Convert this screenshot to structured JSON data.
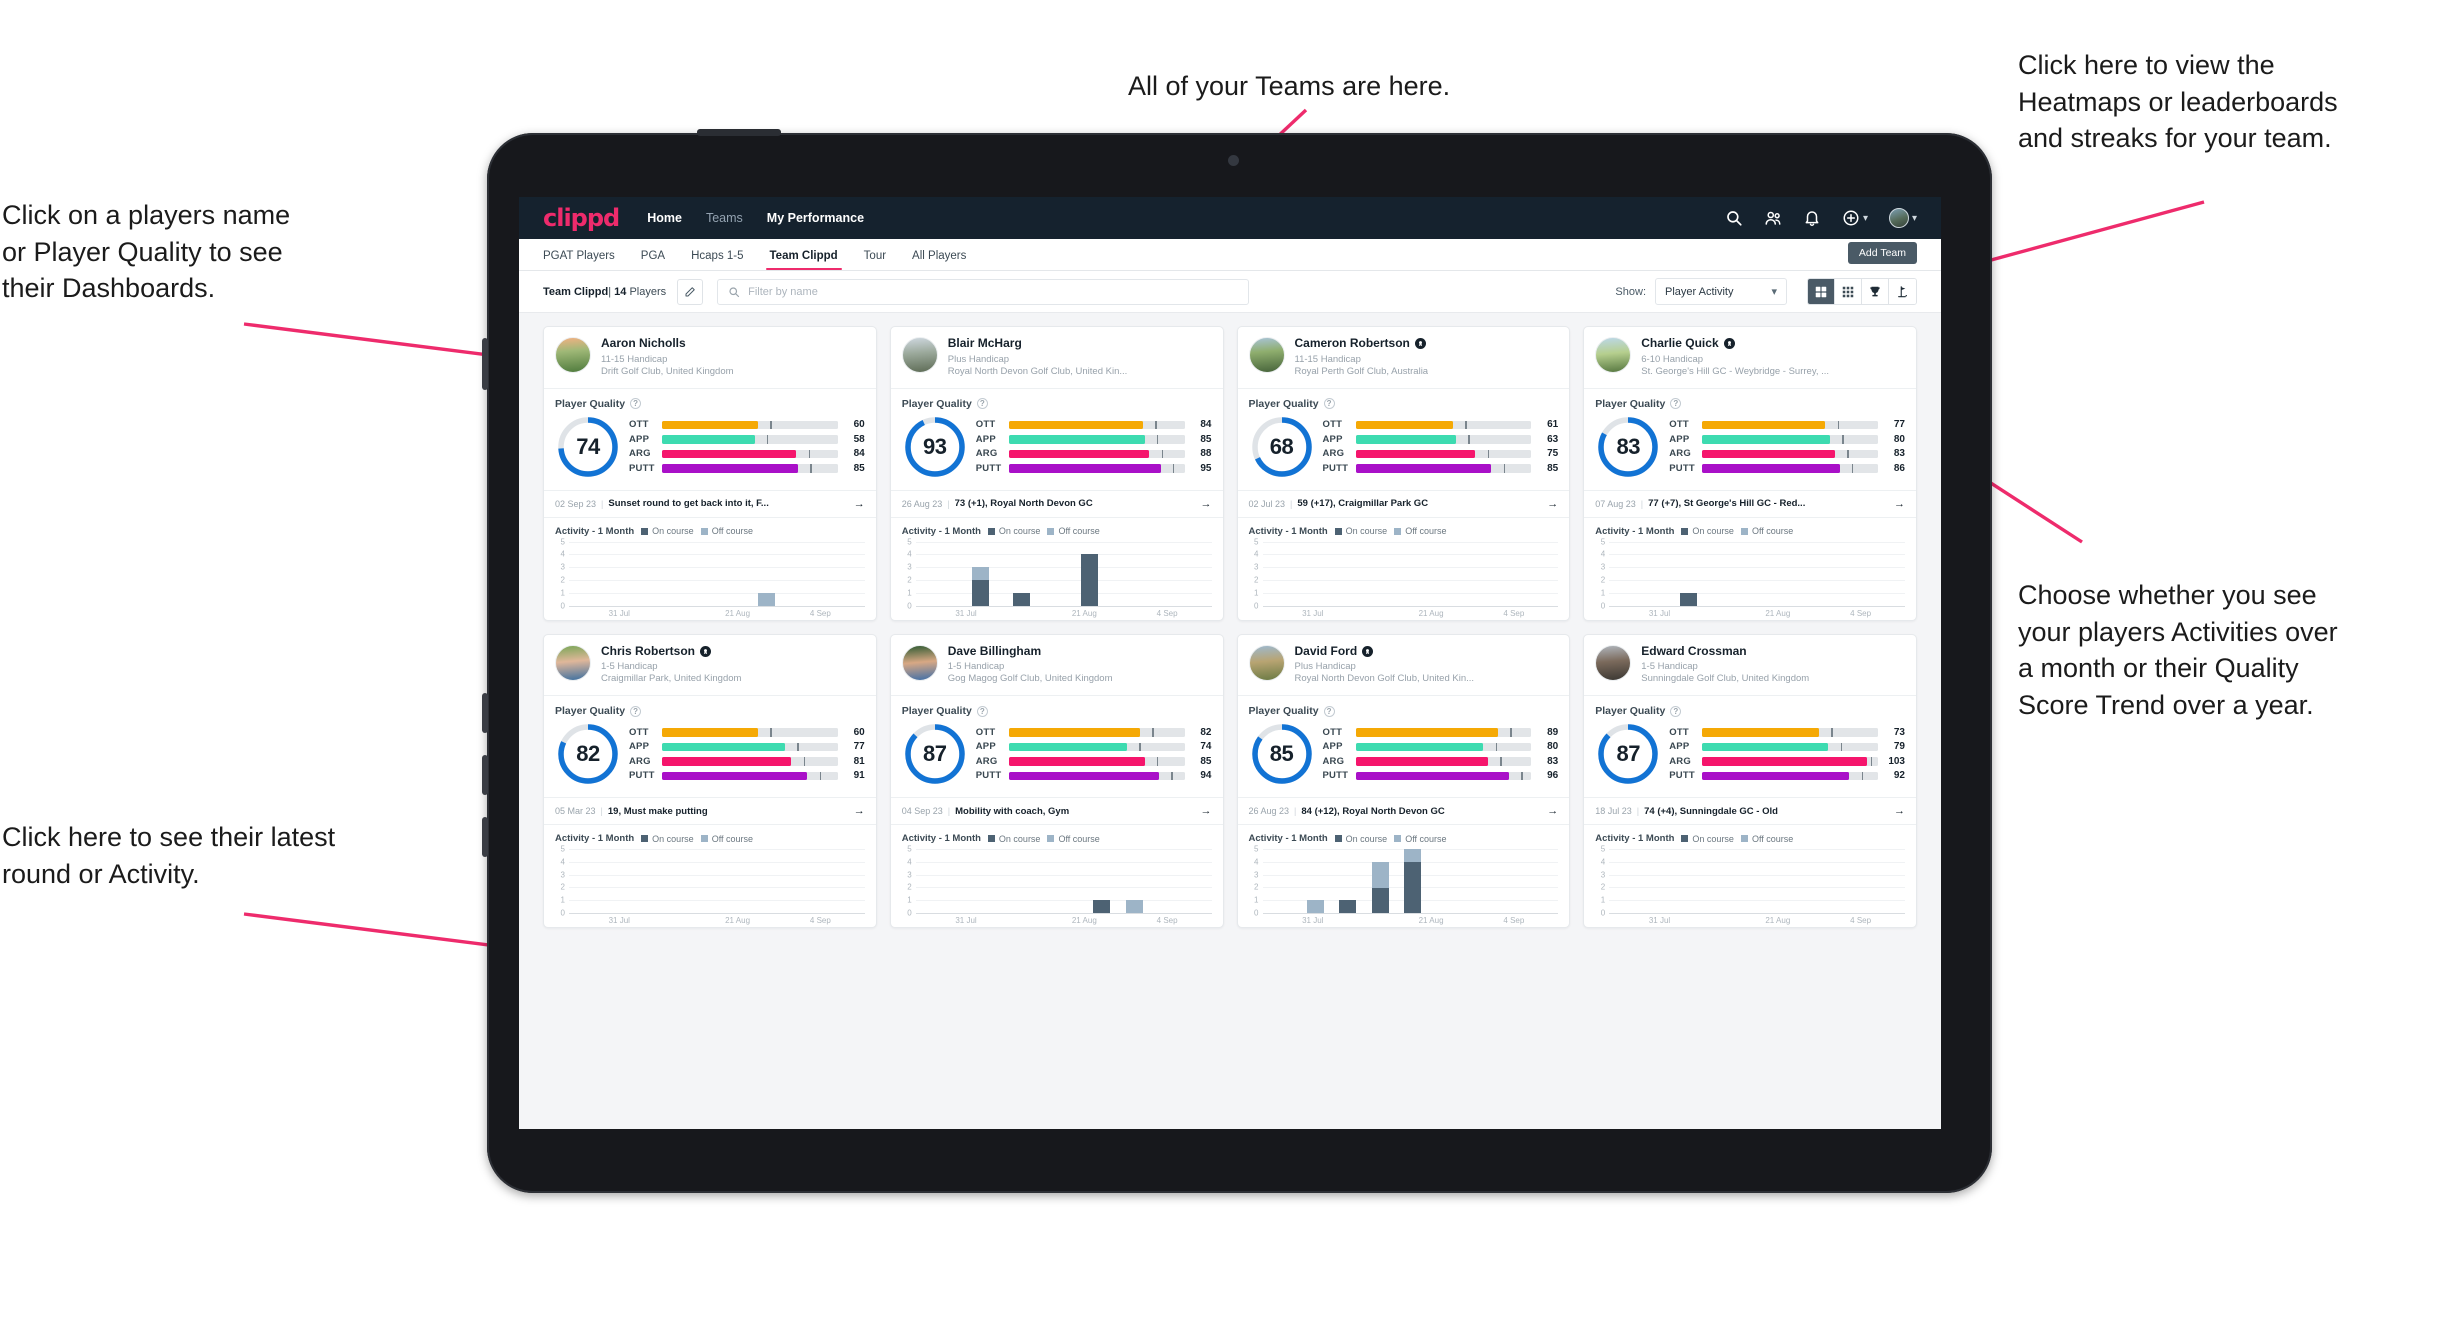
{
  "annotations": [
    {
      "id": "a-players",
      "text": "Click on a players name\nor Player Quality to see\ntheir Dashboards."
    },
    {
      "id": "a-teams",
      "text": "All of your Teams are here."
    },
    {
      "id": "a-heatmaps",
      "text": "Click here to view the\nHeatmaps or leaderboards\nand streaks for your team."
    },
    {
      "id": "a-activity",
      "text": "Choose whether you see\nyour players Activities over\na month or their Quality\nScore Trend over a year."
    },
    {
      "id": "a-latest",
      "text": "Click here to see their latest\nround or Activity."
    }
  ],
  "accent": "#ee2b6c",
  "topnav": {
    "logo": "clippd",
    "links": [
      {
        "label": "Home",
        "active": true
      },
      {
        "label": "Teams",
        "active": false
      },
      {
        "label": "My Performance",
        "active": true
      }
    ],
    "icons": [
      "search-icon",
      "people-icon",
      "bell-icon",
      "plus-circle-icon",
      "avatar"
    ]
  },
  "subtabs": {
    "tabs": [
      {
        "label": "PGAT Players",
        "active": false
      },
      {
        "label": "PGA",
        "active": false
      },
      {
        "label": "Hcaps 1-5",
        "active": false
      },
      {
        "label": "Team Clippd",
        "active": true
      },
      {
        "label": "Tour",
        "active": false
      },
      {
        "label": "All Players",
        "active": false
      }
    ],
    "add_team_label": "Add Team"
  },
  "filterbar": {
    "team_name": "Team Clippd",
    "separator": "|",
    "player_count": "14",
    "players_word": "Players",
    "edit_icon": "pencil-icon",
    "search_placeholder": "Filter by name",
    "show_label": "Show:",
    "show_value": "Player Activity",
    "view_buttons": [
      "grid-large-icon",
      "grid-small-icon",
      "trophy-icon",
      "golf-flag-icon"
    ]
  },
  "card_labels": {
    "player_quality": "Player Quality",
    "activity": "Activity - 1 Month",
    "legend_on": "On course",
    "legend_off": "Off course",
    "metrics": [
      "OTT",
      "APP",
      "ARG",
      "PUTT"
    ]
  },
  "metric_colors": {
    "OTT": "#f5a905",
    "APP": "#3ddbb0",
    "ARG": "#f5156c",
    "PUTT": "#a910c8",
    "ring": "#1273d4",
    "ring_track": "#dfe3e7",
    "on_course": "#4d6273",
    "off_course": "#9db4c7"
  },
  "chart_data": {
    "type": "bar",
    "title": "Activity - 1 Month",
    "ylabel": "",
    "xlabel": "",
    "ylim": [
      0,
      5
    ],
    "yticks": [
      0,
      1,
      2,
      3,
      4,
      5
    ],
    "xticks": [
      "31 Jul",
      "21 Aug",
      "4 Sep"
    ],
    "grid": true,
    "legend": [
      "On course",
      "Off course"
    ],
    "stacked": true
  },
  "players": [
    {
      "name": "Aaron Nicholls",
      "verified": false,
      "handicap": "11-15 Handicap",
      "club": "Drift Golf Club, United Kingdom",
      "quality": 74,
      "metrics": {
        "OTT": 60,
        "APP": 58,
        "ARG": 84,
        "PUTT": 85
      },
      "round": {
        "date": "02 Sep 23",
        "text": "Sunset round to get back into it, F..."
      },
      "activity": {
        "bars": [
          {
            "x": 0.64,
            "on": 0,
            "off": 1
          }
        ]
      }
    },
    {
      "name": "Blair McHarg",
      "verified": false,
      "handicap": "Plus Handicap",
      "club": "Royal North Devon Golf Club, United Kin...",
      "quality": 93,
      "metrics": {
        "OTT": 84,
        "APP": 85,
        "ARG": 88,
        "PUTT": 95
      },
      "round": {
        "date": "26 Aug 23",
        "text": "73 (+1), Royal North Devon GC"
      },
      "activity": {
        "bars": [
          {
            "x": 0.19,
            "on": 2,
            "off": 1
          },
          {
            "x": 0.33,
            "on": 1,
            "off": 0
          },
          {
            "x": 0.56,
            "on": 4,
            "off": 0
          }
        ]
      }
    },
    {
      "name": "Cameron Robertson",
      "verified": true,
      "handicap": "11-15 Handicap",
      "club": "Royal Perth Golf Club, Australia",
      "quality": 68,
      "metrics": {
        "OTT": 61,
        "APP": 63,
        "ARG": 75,
        "PUTT": 85
      },
      "round": {
        "date": "02 Jul 23",
        "text": "59 (+17), Craigmillar Park GC"
      },
      "activity": {
        "bars": []
      }
    },
    {
      "name": "Charlie Quick",
      "verified": true,
      "handicap": "6-10 Handicap",
      "club": "St. George's Hill GC - Weybridge - Surrey, ...",
      "quality": 83,
      "metrics": {
        "OTT": 77,
        "APP": 80,
        "ARG": 83,
        "PUTT": 86
      },
      "round": {
        "date": "07 Aug 23",
        "text": "77 (+7), St George's Hill GC - Red..."
      },
      "activity": {
        "bars": [
          {
            "x": 0.24,
            "on": 1,
            "off": 0
          }
        ]
      }
    },
    {
      "name": "Chris Robertson",
      "verified": true,
      "handicap": "1-5 Handicap",
      "club": "Craigmillar Park, United Kingdom",
      "quality": 82,
      "metrics": {
        "OTT": 60,
        "APP": 77,
        "ARG": 81,
        "PUTT": 91
      },
      "round": {
        "date": "05 Mar 23",
        "text": "19, Must make putting"
      },
      "activity": {
        "bars": []
      }
    },
    {
      "name": "Dave Billingham",
      "verified": false,
      "handicap": "1-5 Handicap",
      "club": "Gog Magog Golf Club, United Kingdom",
      "quality": 87,
      "metrics": {
        "OTT": 82,
        "APP": 74,
        "ARG": 85,
        "PUTT": 94
      },
      "round": {
        "date": "04 Sep 23",
        "text": "Mobility with coach, Gym"
      },
      "activity": {
        "bars": [
          {
            "x": 0.6,
            "on": 1,
            "off": 0
          },
          {
            "x": 0.71,
            "on": 0,
            "off": 1
          }
        ]
      }
    },
    {
      "name": "David Ford",
      "verified": true,
      "handicap": "Plus Handicap",
      "club": "Royal North Devon Golf Club, United Kin...",
      "quality": 85,
      "metrics": {
        "OTT": 89,
        "APP": 80,
        "ARG": 83,
        "PUTT": 96
      },
      "round": {
        "date": "26 Aug 23",
        "text": "84 (+12), Royal North Devon GC"
      },
      "activity": {
        "bars": [
          {
            "x": 0.15,
            "on": 0,
            "off": 1
          },
          {
            "x": 0.26,
            "on": 1,
            "off": 0
          },
          {
            "x": 0.37,
            "on": 2,
            "off": 2
          },
          {
            "x": 0.48,
            "on": 4,
            "off": 1
          }
        ]
      }
    },
    {
      "name": "Edward Crossman",
      "verified": false,
      "handicap": "1-5 Handicap",
      "club": "Sunningdale Golf Club, United Kingdom",
      "quality": 87,
      "metrics": {
        "OTT": 73,
        "APP": 79,
        "ARG": 103,
        "PUTT": 92
      },
      "round": {
        "date": "18 Jul 23",
        "text": "74 (+4), Sunningdale GC - Old"
      },
      "activity": {
        "bars": []
      }
    }
  ]
}
